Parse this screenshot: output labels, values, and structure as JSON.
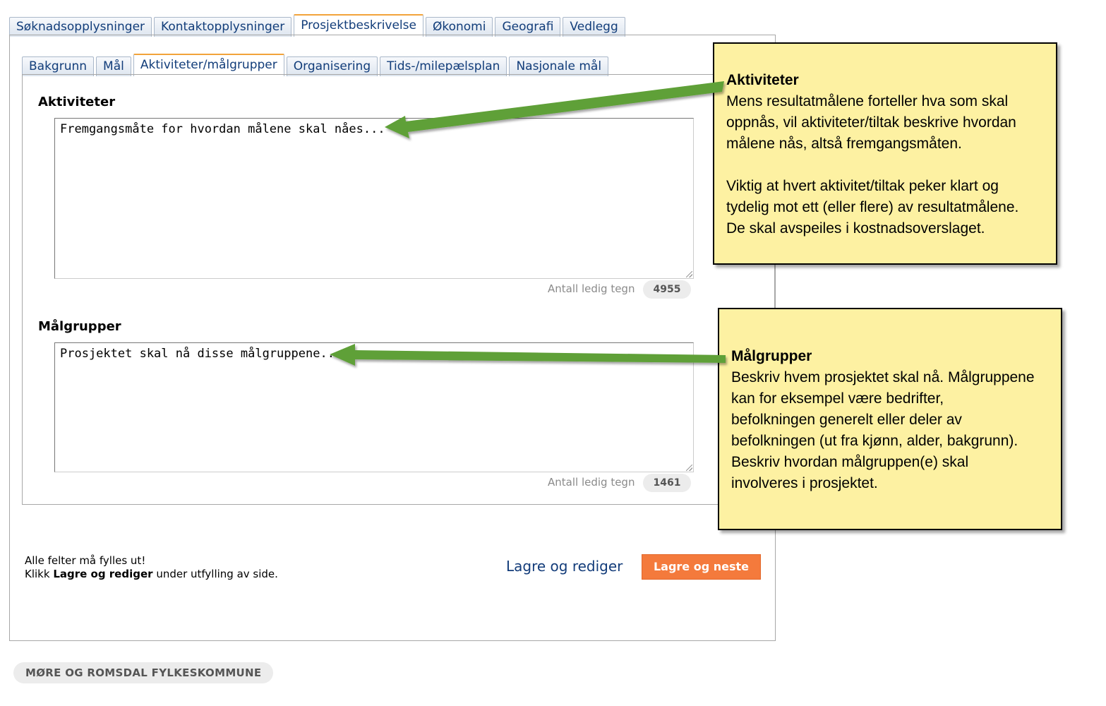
{
  "main_tabs": [
    {
      "label": "Søknadsopplysninger"
    },
    {
      "label": "Kontaktopplysninger"
    },
    {
      "label": "Prosjektbeskrivelse",
      "active": true
    },
    {
      "label": "Økonomi"
    },
    {
      "label": "Geografi"
    },
    {
      "label": "Vedlegg"
    }
  ],
  "sub_tabs": [
    {
      "label": "Bakgrunn"
    },
    {
      "label": "Mål"
    },
    {
      "label": "Aktiviteter/målgrupper",
      "active": true
    },
    {
      "label": "Organisering"
    },
    {
      "label": "Tids-/milepælsplan"
    },
    {
      "label": "Nasjonale mål"
    }
  ],
  "aktiviteter": {
    "label": "Aktiviteter",
    "value": "Fremgangsmåte for hvordan målene skal nåes...",
    "counter_label": "Antall ledig tegn",
    "counter_value": "4955"
  },
  "malgrupper": {
    "label": "Målgrupper",
    "value": "Prosjektet skal nå disse målgruppene...",
    "counter_label": "Antall ledig tegn",
    "counter_value": "1461"
  },
  "note": {
    "line1": "Alle felter må fylles ut!",
    "line2_pre": "Klikk ",
    "line2_bold": "Lagre og rediger",
    "line2_post": " under utfylling av side."
  },
  "actions": {
    "save_edit": "Lagre og rediger",
    "save_next": "Lagre og neste"
  },
  "footer": {
    "org": "MØRE OG ROMSDAL FYLKESKOMMUNE"
  },
  "callouts": {
    "aktiviteter": {
      "title": "Aktiviteter",
      "p1_lines": [
        "Mens resultatmålene forteller hva som skal",
        "oppnås, vil aktiviteter/tiltak beskrive hvordan",
        "målene nås, altså fremgangsmåten."
      ],
      "p2_lines": [
        "Viktig at hvert aktivitet/tiltak peker klart og",
        "tydelig mot ett (eller flere) av resultatmålene.",
        "De skal avspeiles i kostnadsoverslaget."
      ]
    },
    "malgrupper": {
      "title": "Målgrupper",
      "lines": [
        "Beskriv hvem prosjektet skal nå. Målgruppene",
        "kan for eksempel være bedrifter,",
        "befolkningen generelt eller deler av",
        "befolkningen (ut fra kjønn, alder, bakgrunn).",
        "Beskriv hvordan målgruppen(e) skal",
        "involveres i prosjektet."
      ]
    }
  },
  "colors": {
    "accent_orange": "#f47a3c",
    "link_blue": "#133c7a",
    "callout_bg": "#fdf1a2",
    "arrow_green": "#5fa037"
  }
}
